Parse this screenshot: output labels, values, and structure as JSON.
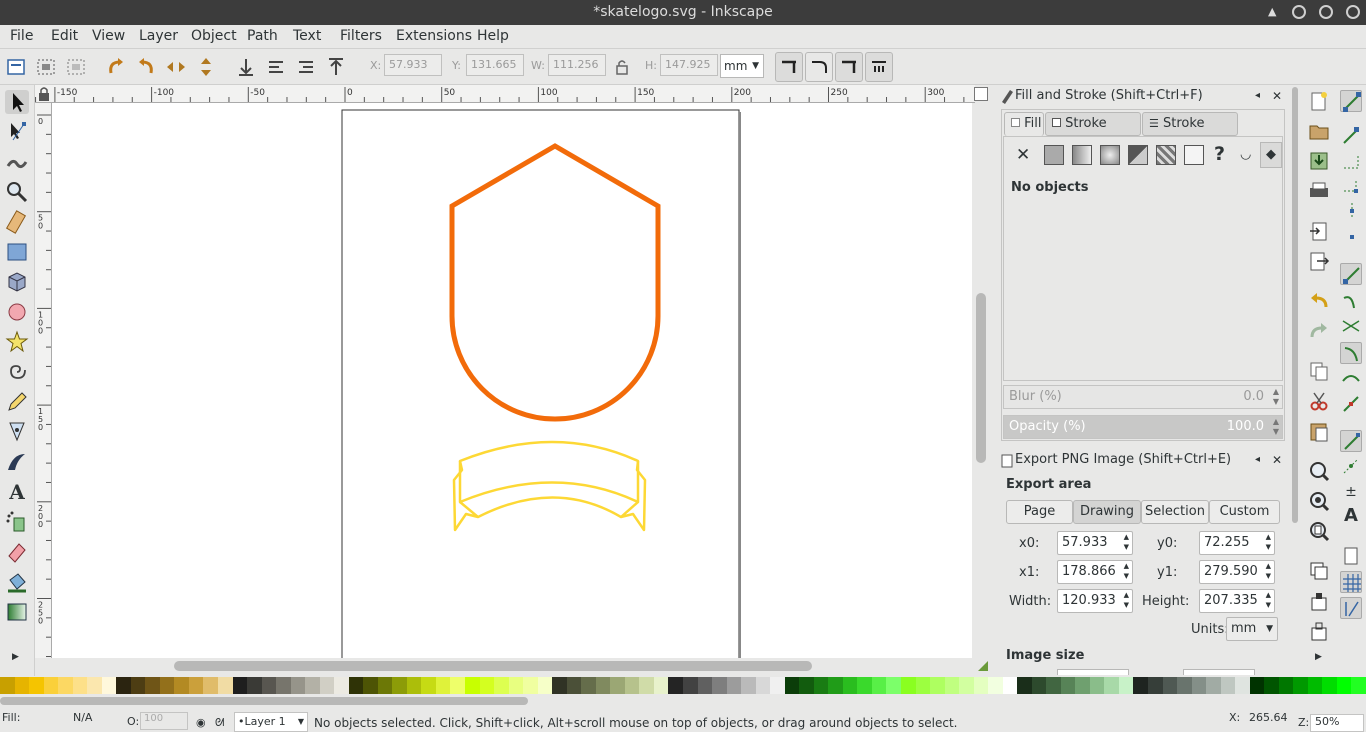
{
  "window": {
    "title": "*skatelogo.svg - Inkscape"
  },
  "menu": [
    "File",
    "Edit",
    "View",
    "Layer",
    "Object",
    "Path",
    "Text",
    "Filters",
    "Extensions",
    "Help"
  ],
  "toolcontrols": {
    "x_label": "X:",
    "x_value": "57.933",
    "y_label": "Y:",
    "y_value": "131.665",
    "w_label": "W:",
    "w_value": "111.256",
    "h_label": "H:",
    "h_value": "147.925",
    "unit": "mm"
  },
  "ruler": {
    "top_ticks": [
      "-150",
      "-100",
      "-50",
      "0",
      "50",
      "100",
      "150",
      "200",
      "250",
      "300"
    ],
    "left_ticks": [
      "0",
      "50",
      "100",
      "150",
      "200",
      "250"
    ]
  },
  "fill_stroke": {
    "title": "Fill and Stroke (Shift+Ctrl+F)",
    "tabs": [
      "Fill",
      "Stroke paint",
      "Stroke style"
    ],
    "no_objects": "No objects",
    "blur_label": "Blur (%)",
    "blur_value": "0.0",
    "opacity_label": "Opacity (%)",
    "opacity_value": "100.0"
  },
  "export_png": {
    "title": "Export PNG Image (Shift+Ctrl+E)",
    "area_label": "Export area",
    "area_buttons": [
      "Page",
      "Drawing",
      "Selection",
      "Custom"
    ],
    "active_area": "Drawing",
    "x0_label": "x0:",
    "x0": "57.933",
    "y0_label": "y0:",
    "y0": "72.255",
    "x1_label": "x1:",
    "x1": "178.866",
    "y1_label": "y1:",
    "y1": "279.590",
    "width_label": "Width:",
    "width": "120.933",
    "height_label": "Height:",
    "height": "207.335",
    "units_label": "Units:",
    "units": "mm",
    "image_size_label": "Image size"
  },
  "status": {
    "fill_label": "Fill:",
    "fill_value": "N/A",
    "opacity_label": "O:",
    "opacity_value": "100",
    "layer": "•Layer 1",
    "message": "No objects selected. Click, Shift+click, Alt+scroll mouse on top of objects, or drag around objects to select.",
    "coord_x_label": "X:",
    "coord_x": "265.64",
    "zoom_label": "Z:",
    "zoom": "50%"
  },
  "colors": {
    "shield": "#f26b0a",
    "banner": "#fdd835",
    "titlebar": "#3c3c3c"
  },
  "palette": [
    "#c8a000",
    "#e6b400",
    "#f5c400",
    "#fad03a",
    "#fcd863",
    "#fde089",
    "#fbe7ae",
    "#fff8dc",
    "#2b2410",
    "#4d3d13",
    "#6f5517",
    "#93701b",
    "#b38a23",
    "#cba03b",
    "#e0bc6a",
    "#f1dca4",
    "#1e1e1e",
    "#3a3a36",
    "#585650",
    "#77756c",
    "#96948a",
    "#b3b1a6",
    "#d1cfc5",
    "#eceae2",
    "#2f3306",
    "#4d5405",
    "#6c7806",
    "#8c9c08",
    "#acbe0a",
    "#c6db14",
    "#dff23a",
    "#eeff6a",
    "#c8ff00",
    "#d4ff20",
    "#ddff50",
    "#e8ff80",
    "#f0ffa0",
    "#f6ffc8",
    "#303325",
    "#4b5038",
    "#656d4b",
    "#808a5f",
    "#9ba774",
    "#b6c28c",
    "#d0dca8",
    "#e8f2cc",
    "#242424",
    "#424242",
    "#606060",
    "#7e7e7e",
    "#9c9c9c",
    "#bababa",
    "#d8d8d8",
    "#f0f0f0",
    "#0b3d09",
    "#125c0e",
    "#197c13",
    "#209c18",
    "#2abd1f",
    "#3ad92c",
    "#58ef47",
    "#7cff6a",
    "#8aff20",
    "#9cff40",
    "#aeff60",
    "#c0ff80",
    "#d2ffa0",
    "#e4ffc0",
    "#f2ffe0",
    "#ffffff",
    "#1a2e1a",
    "#2d4a2d",
    "#416641",
    "#578357",
    "#6fa06f",
    "#8abd8a",
    "#a8d9a8",
    "#c8f2c8",
    "#1e2420",
    "#363e39",
    "#4f5953",
    "#69746d",
    "#848f88",
    "#a1aba4",
    "#bfc7c1",
    "#dfe4e0",
    "#003300",
    "#005500",
    "#007700",
    "#009900",
    "#00bb00",
    "#00dd00",
    "#00ff00",
    "#22ff22"
  ]
}
